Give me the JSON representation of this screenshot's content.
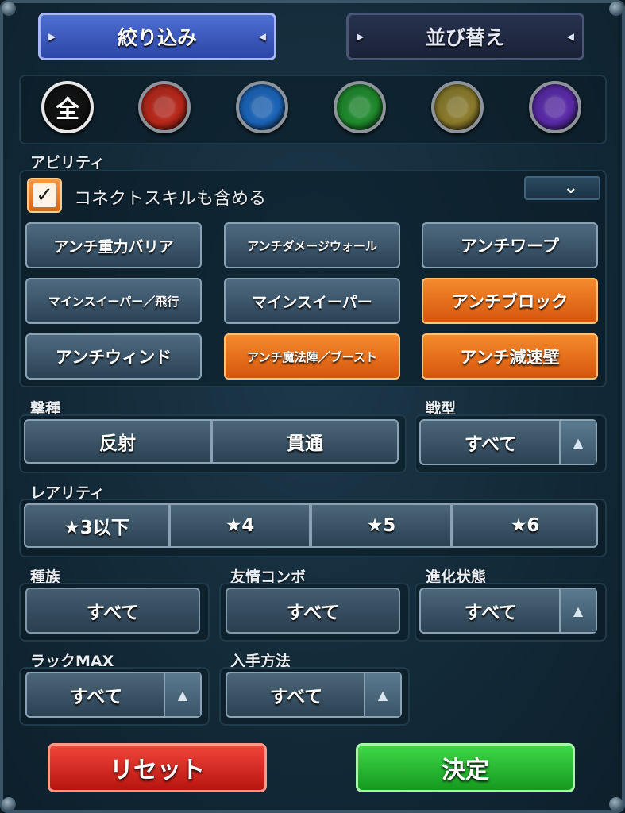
{
  "tabs": {
    "filter_label": "絞り込み",
    "sort_label": "並び替え"
  },
  "elements": [
    {
      "name": "element-all-icon",
      "symbol": "全",
      "color": "#111111"
    },
    {
      "name": "element-fire-icon",
      "symbol": "",
      "color": "#b8271a"
    },
    {
      "name": "element-water-icon",
      "symbol": "",
      "color": "#1b64b8"
    },
    {
      "name": "element-wood-icon",
      "symbol": "",
      "color": "#1f8a2c"
    },
    {
      "name": "element-light-icon",
      "symbol": "",
      "color": "#8a7a2a"
    },
    {
      "name": "element-dark-icon",
      "symbol": "",
      "color": "#5a2aa8"
    }
  ],
  "ability": {
    "label": "アビリティ",
    "connect_checkbox_label": "コネクトスキルも含める",
    "connect_checked": true,
    "expand_icon": "chevron-down-icon",
    "buttons": [
      {
        "label": "アンチ重力バリア",
        "selected": false
      },
      {
        "label": "アンチダメージウォール",
        "selected": false
      },
      {
        "label": "アンチワープ",
        "selected": false
      },
      {
        "label": "マインスイーパー／飛行",
        "selected": false
      },
      {
        "label": "マインスイーパー",
        "selected": false
      },
      {
        "label": "アンチブロック",
        "selected": true
      },
      {
        "label": "アンチウィンド",
        "selected": false
      },
      {
        "label": "アンチ魔法陣／ブースト",
        "selected": true
      },
      {
        "label": "アンチ減速壁",
        "selected": true
      }
    ]
  },
  "attack_type": {
    "label": "撃種",
    "options": [
      "反射",
      "貫通"
    ]
  },
  "battle_type": {
    "label": "戦型",
    "value": "すべて"
  },
  "rarity": {
    "label": "レアリティ",
    "options": [
      "★3以下",
      "★4",
      "★5",
      "★6"
    ]
  },
  "tribe": {
    "label": "種族",
    "value": "すべて"
  },
  "friend_combo": {
    "label": "友情コンボ",
    "value": "すべて"
  },
  "evolution": {
    "label": "進化状態",
    "value": "すべて"
  },
  "luck_max": {
    "label": "ラックMAX",
    "value": "すべて"
  },
  "obtain_method": {
    "label": "入手方法",
    "value": "すべて"
  },
  "actions": {
    "reset_label": "リセット",
    "confirm_label": "決定"
  },
  "colors": {
    "accent_orange": "#e8701c",
    "reset_red": "#d2231b",
    "confirm_green": "#27b32a",
    "tab_blue": "#3e5cc4"
  }
}
